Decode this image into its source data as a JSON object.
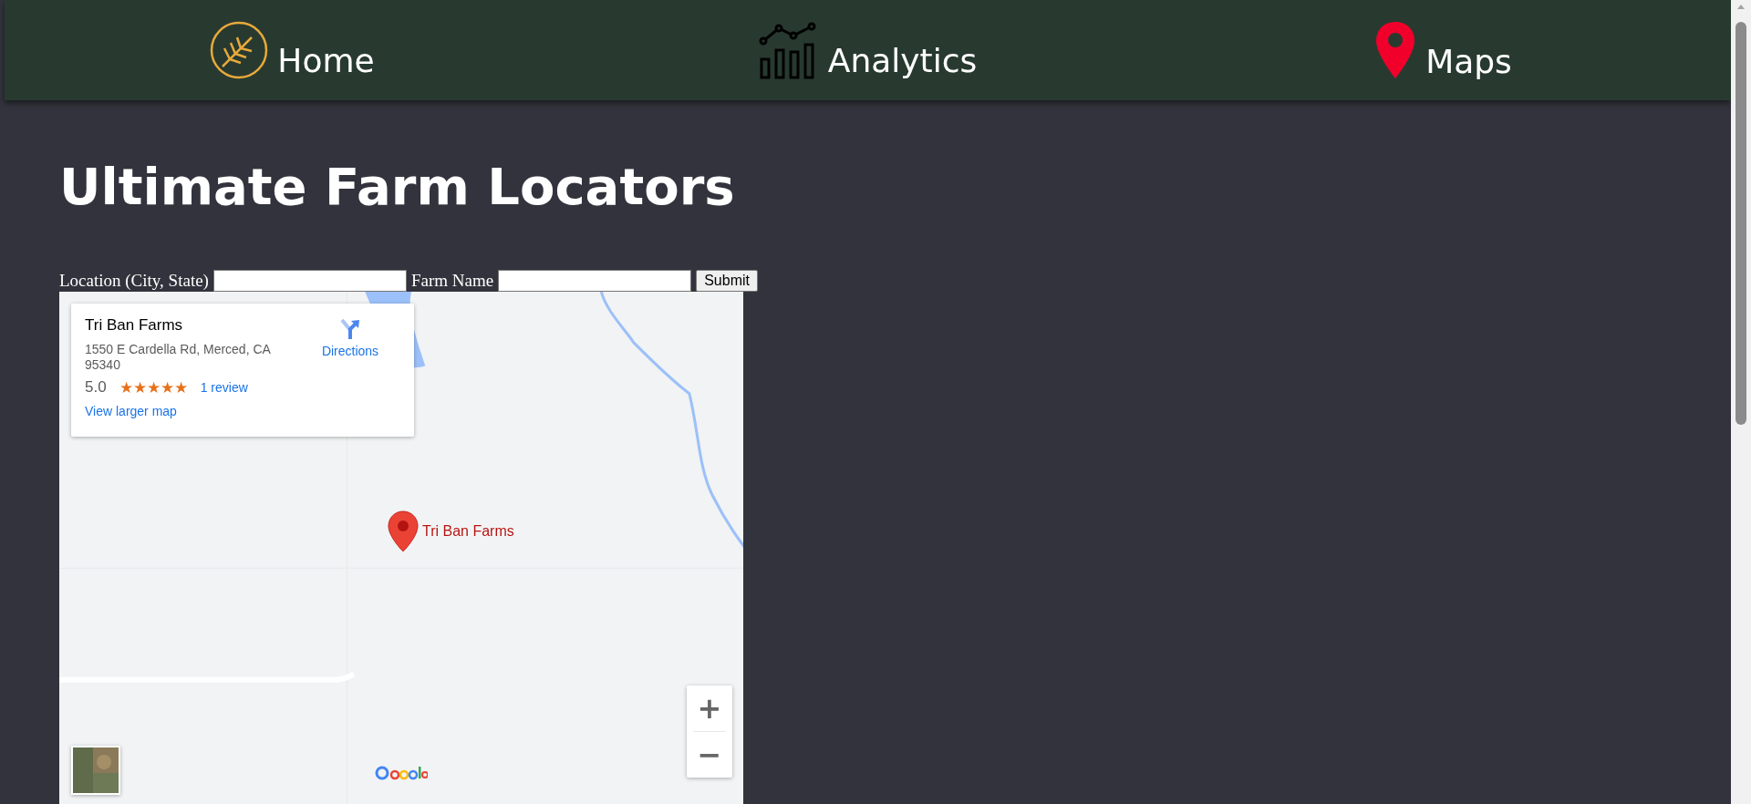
{
  "nav": [
    {
      "kind": "wheat",
      "label": "Home"
    },
    {
      "kind": "chart",
      "label": "Analytics"
    },
    {
      "kind": "pin",
      "label": "Maps"
    }
  ],
  "title": "Ultimate Farm Locators",
  "form": {
    "fields": [
      {
        "label": "Location (City, State)"
      },
      {
        "label": "Farm Name"
      }
    ],
    "submit": "Submit"
  },
  "map": {
    "place": {
      "name": "Tri Ban Farms",
      "address": "1550 E Cardella Rd, Merced, CA 95340",
      "rating": "5.0",
      "stars": 5,
      "reviews": "1 review",
      "directions": "Directions",
      "larger_map": "View larger map"
    },
    "marker_label": "Tri Ban Farms",
    "zoom_in": "+",
    "zoom_out": "−"
  }
}
